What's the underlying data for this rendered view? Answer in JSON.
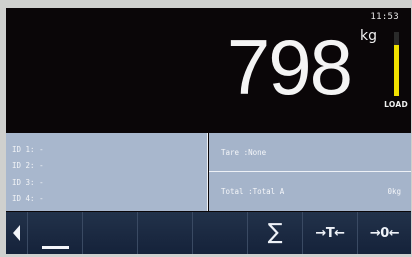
{
  "display": {
    "clock": "11:53",
    "weight": "798",
    "unit": "kg",
    "load_label": "LOAD",
    "load_level": 0.8
  },
  "ids": [
    {
      "label": "ID 1: -"
    },
    {
      "label": "ID 2: -"
    },
    {
      "label": "ID 3: -"
    },
    {
      "label": "ID 4: -"
    }
  ],
  "info": {
    "tare": "Tare :None",
    "total_label": "Total :Total A",
    "total_value": "0kg"
  },
  "softkeys": {
    "back_icon": "left-arrow-icon",
    "sum_label": "∑",
    "tare_label": "→T←",
    "zero_label": "→0←"
  },
  "colors": {
    "background": "#0a0608",
    "info_panel": "#a8b7cd",
    "softkey_bar": "#1c2a3f",
    "load_fill": "#f0e000"
  }
}
